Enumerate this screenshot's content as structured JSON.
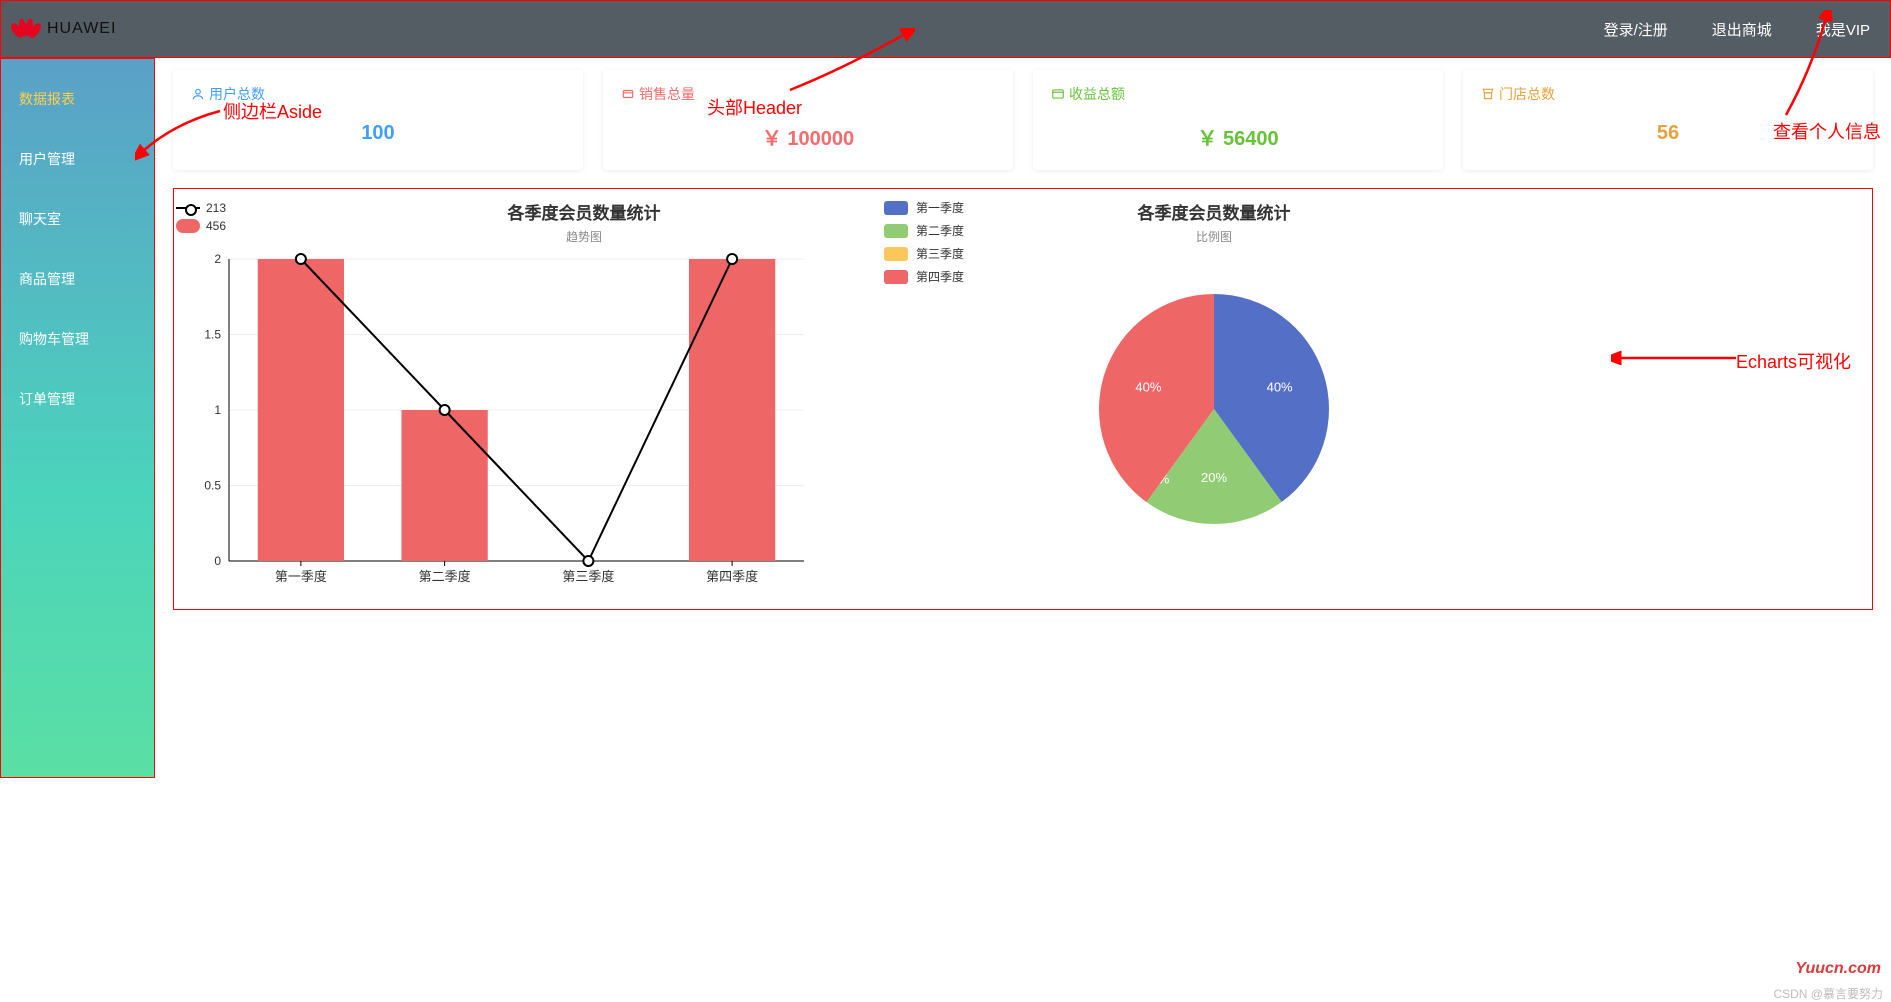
{
  "header": {
    "brand": "HUAWEI",
    "links": {
      "login": "登录/注册",
      "exit": "退出商城",
      "vip": "我是VIP"
    }
  },
  "sidebar": {
    "items": [
      {
        "label": "数据报表",
        "active": true
      },
      {
        "label": "用户管理"
      },
      {
        "label": "聊天室"
      },
      {
        "label": "商品管理"
      },
      {
        "label": "购物车管理"
      },
      {
        "label": "订单管理"
      }
    ]
  },
  "cards": {
    "users": {
      "title": "用户总数",
      "value": "100"
    },
    "sales": {
      "title": "销售总量",
      "value": "￥ 100000"
    },
    "profit": {
      "title": "收益总额",
      "value": "￥ 56400"
    },
    "stores": {
      "title": "门店总数",
      "value": "56"
    }
  },
  "annotations": {
    "aside_label": "侧边栏Aside",
    "header_label": "头部Header",
    "vip_label": "查看个人信息",
    "echarts_label": "Echarts可视化"
  },
  "bar_legend": {
    "line": "213",
    "bar": "456"
  },
  "watermark": "Yuucn.com",
  "csdn": "CSDN @慕言要努力",
  "chart_data": [
    {
      "type": "bar+line",
      "title": "各季度会员数量统计",
      "subtitle": "趋势图",
      "categories": [
        "第一季度",
        "第二季度",
        "第三季度",
        "第四季度"
      ],
      "series": [
        {
          "name": "456",
          "type": "bar",
          "values": [
            2,
            1,
            0,
            2
          ],
          "color": "#ee6666"
        },
        {
          "name": "213",
          "type": "line",
          "values": [
            2,
            1,
            0,
            2
          ],
          "color": "#000"
        }
      ],
      "ylim": [
        0,
        2
      ],
      "y_ticks": [
        0,
        0.5,
        1,
        1.5,
        2
      ]
    },
    {
      "type": "pie",
      "title": "各季度会员数量统计",
      "subtitle": "比例图",
      "slices": [
        {
          "name": "第一季度",
          "pct": 40,
          "color": "#5470c6"
        },
        {
          "name": "第二季度",
          "pct": 20,
          "color": "#91cc75"
        },
        {
          "name": "第三季度",
          "pct": 0,
          "color": "#fac858"
        },
        {
          "name": "第四季度",
          "pct": 40,
          "color": "#ee6666"
        }
      ],
      "legend": [
        "第一季度",
        "第二季度",
        "第三季度",
        "第四季度"
      ]
    }
  ]
}
